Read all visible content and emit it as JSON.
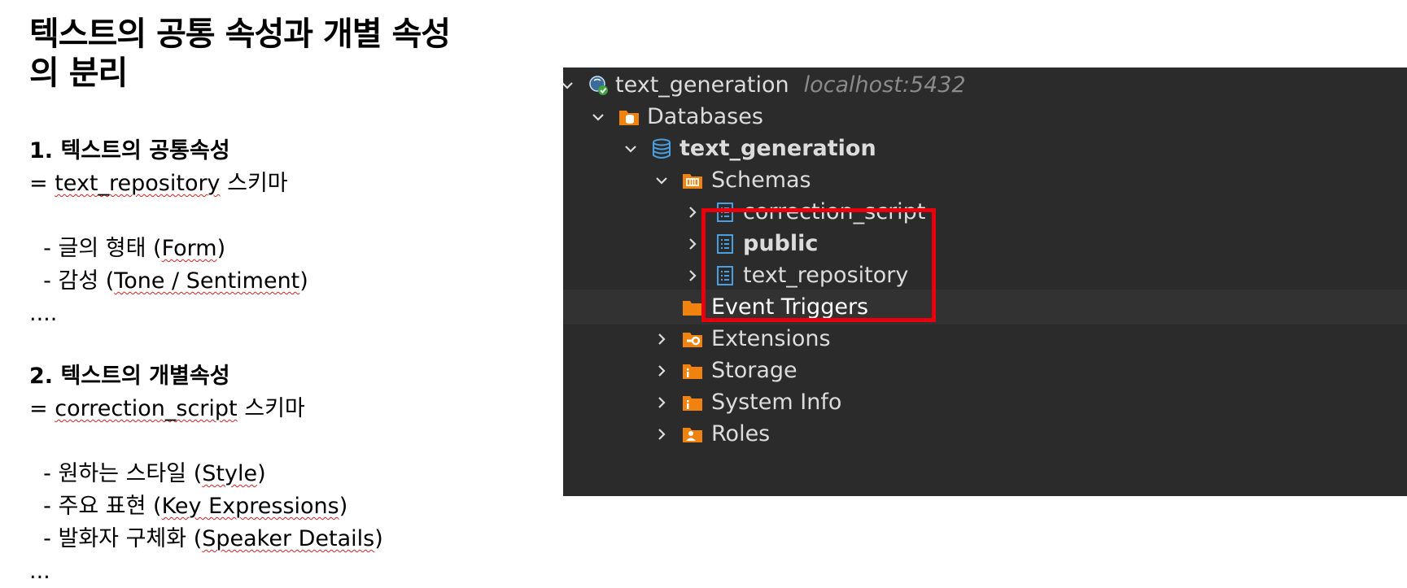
{
  "slide": {
    "title_line1": "텍스트의 공통 속성과 개별 속성",
    "title_line2": "의 분리",
    "section1": {
      "heading": "1. 텍스트의 공통속성",
      "schema_prefix": "= ",
      "schema_name": "text_repository",
      "schema_suffix": " 스키마",
      "items": [
        {
          "prefix": "  - 글의 형태 (",
          "term": "Form",
          "suffix": ")"
        },
        {
          "prefix": "  - 감성 (",
          "term": "Tone / Sentiment",
          "suffix": ")"
        }
      ],
      "ellipsis": "...."
    },
    "section2": {
      "heading": "2. 텍스트의 개별속성",
      "schema_prefix": "= ",
      "schema_name": "correction_script",
      "schema_suffix": " 스키마",
      "items": [
        {
          "prefix": "  - 원하는 스타일 (",
          "term": "Style",
          "suffix": ")"
        },
        {
          "prefix": "  - 주요 표현 (",
          "term": "Key Expressions",
          "suffix": ")"
        },
        {
          "prefix": "  - 발화자 구체화 (",
          "term": "Speaker Details",
          "suffix": ")"
        }
      ],
      "ellipsis": "..."
    }
  },
  "tree": {
    "connection": {
      "label": "text_generation",
      "host": "localhost:5432"
    },
    "databases": "Databases",
    "database": "text_generation",
    "schemas": "Schemas",
    "schema_items": [
      "correction_script",
      "public",
      "text_repository"
    ],
    "event_triggers": "Event Triggers",
    "extensions": "Extensions",
    "storage": "Storage",
    "system_info": "System Info",
    "roles": "Roles",
    "colors": {
      "folder": "#f0820f",
      "schema_icon": "#4a9fe0",
      "db_icon": "#4a9fe0",
      "highlight": "#e8000d"
    }
  }
}
